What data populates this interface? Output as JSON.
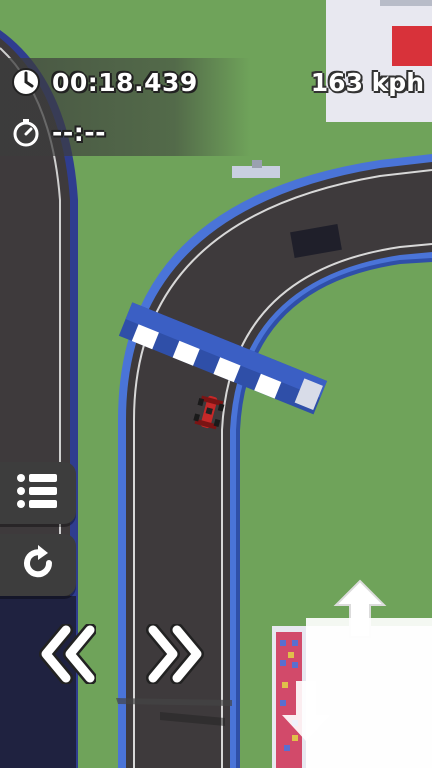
{
  "hud": {
    "current_time": "00:18.439",
    "best_time": "--:--",
    "speed": "163 kph"
  },
  "icons": {
    "clock": "clock-icon",
    "stopwatch": "stopwatch-icon",
    "menu": "list-menu-icon",
    "restart": "restart-icon",
    "rewind": "double-chevron-left-icon",
    "fast_forward": "double-chevron-right-icon",
    "steer_up": "arrow-up-icon",
    "steer_down": "arrow-down-icon"
  },
  "colors": {
    "grass": "#6fa35a",
    "asphalt": "#3e3a3c",
    "track_border": "#3f66c9",
    "car": "#c62828"
  }
}
